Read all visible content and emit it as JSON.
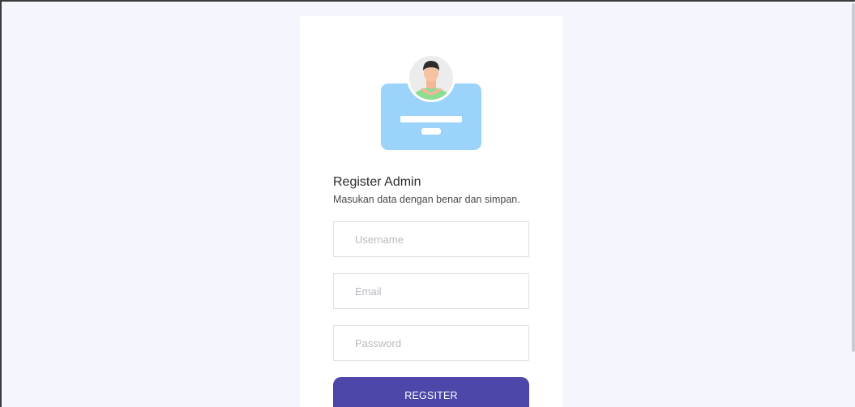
{
  "form": {
    "title": "Register Admin",
    "subtitle": "Masukan data dengan benar dan simpan.",
    "username_placeholder": "Username",
    "email_placeholder": "Email",
    "password_placeholder": "Password",
    "submit_label": "REGSITER"
  },
  "colors": {
    "page_background": "#f3f6fd",
    "card_background": "#ffffff",
    "button": "#4c47a8",
    "id_card": "#9bd3fb"
  },
  "icons": {
    "illustration": "admin-id-card-icon"
  }
}
